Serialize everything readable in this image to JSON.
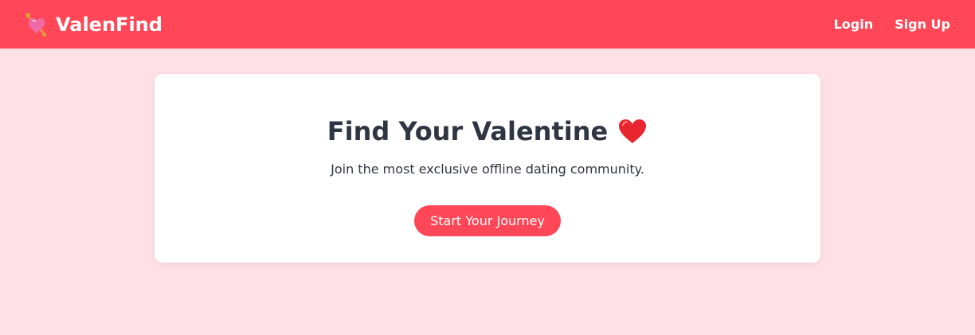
{
  "navbar": {
    "brand_name": "ValenFind",
    "brand_icon": "heart-with-arrow-icon",
    "links": [
      "Login",
      "Sign Up"
    ]
  },
  "hero": {
    "title": "Find Your Valentine",
    "title_icon": "red-heart-icon",
    "subtitle": "Join the most exclusive offline dating community.",
    "cta_label": "Start Your Journey"
  },
  "colors": {
    "accent": "#ff4757",
    "page_background": "#ffe0e6",
    "card_background": "#ffffff",
    "text": "#2f3542"
  }
}
